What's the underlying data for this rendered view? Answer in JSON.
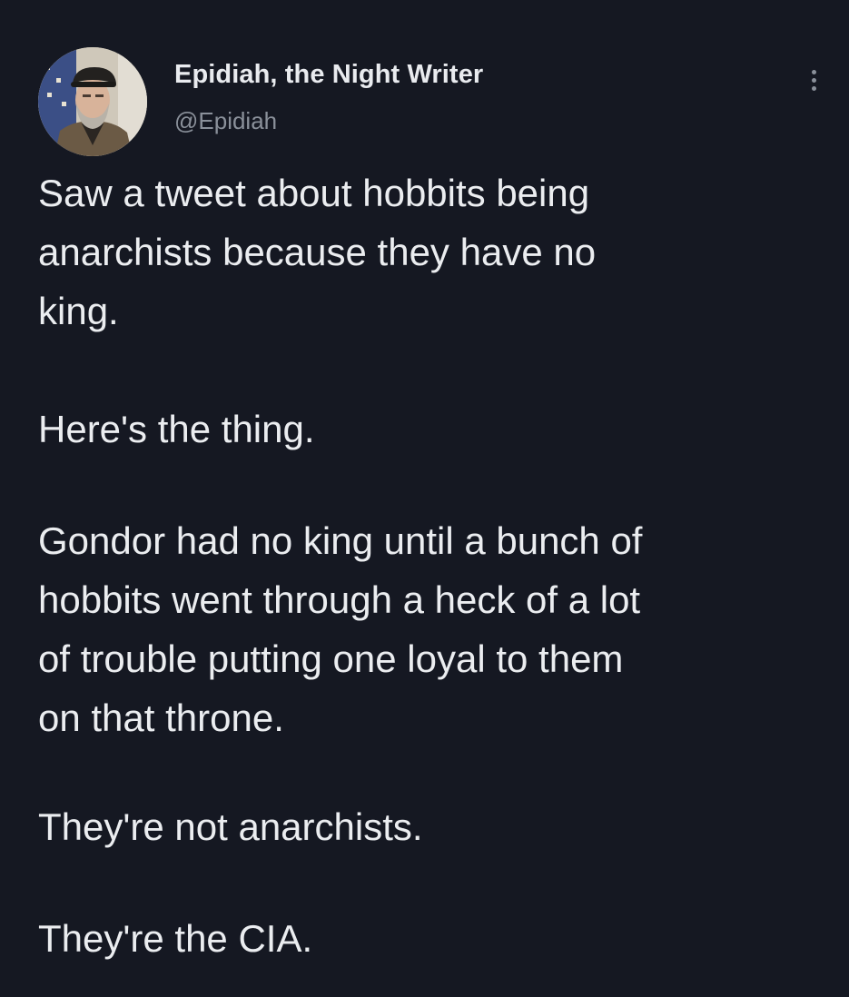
{
  "tweet": {
    "author": {
      "display_name": "Epidiah, the Night Writer",
      "handle": "@Epidiah",
      "avatar_icon": "profile-photo-man-with-cap-and-beard"
    },
    "more_icon": "vertical-ellipsis-icon",
    "paragraphs": [
      {
        "lines": [
          "Saw a tweet about hobbits being",
          "anarchists because they have no",
          "king."
        ]
      },
      {
        "lines": [
          "Here's the thing."
        ]
      },
      {
        "lines": [
          "Gondor had no king until a bunch of",
          "hobbits went through a heck of a lot",
          "of trouble putting one loyal to them",
          "on that throne."
        ]
      },
      {
        "lines": [
          "They're not anarchists."
        ]
      },
      {
        "lines": [
          "They're the CIA."
        ]
      }
    ]
  },
  "colors": {
    "background": "#151822",
    "text_primary": "#ebedf0",
    "text_secondary": "#8a909a"
  }
}
